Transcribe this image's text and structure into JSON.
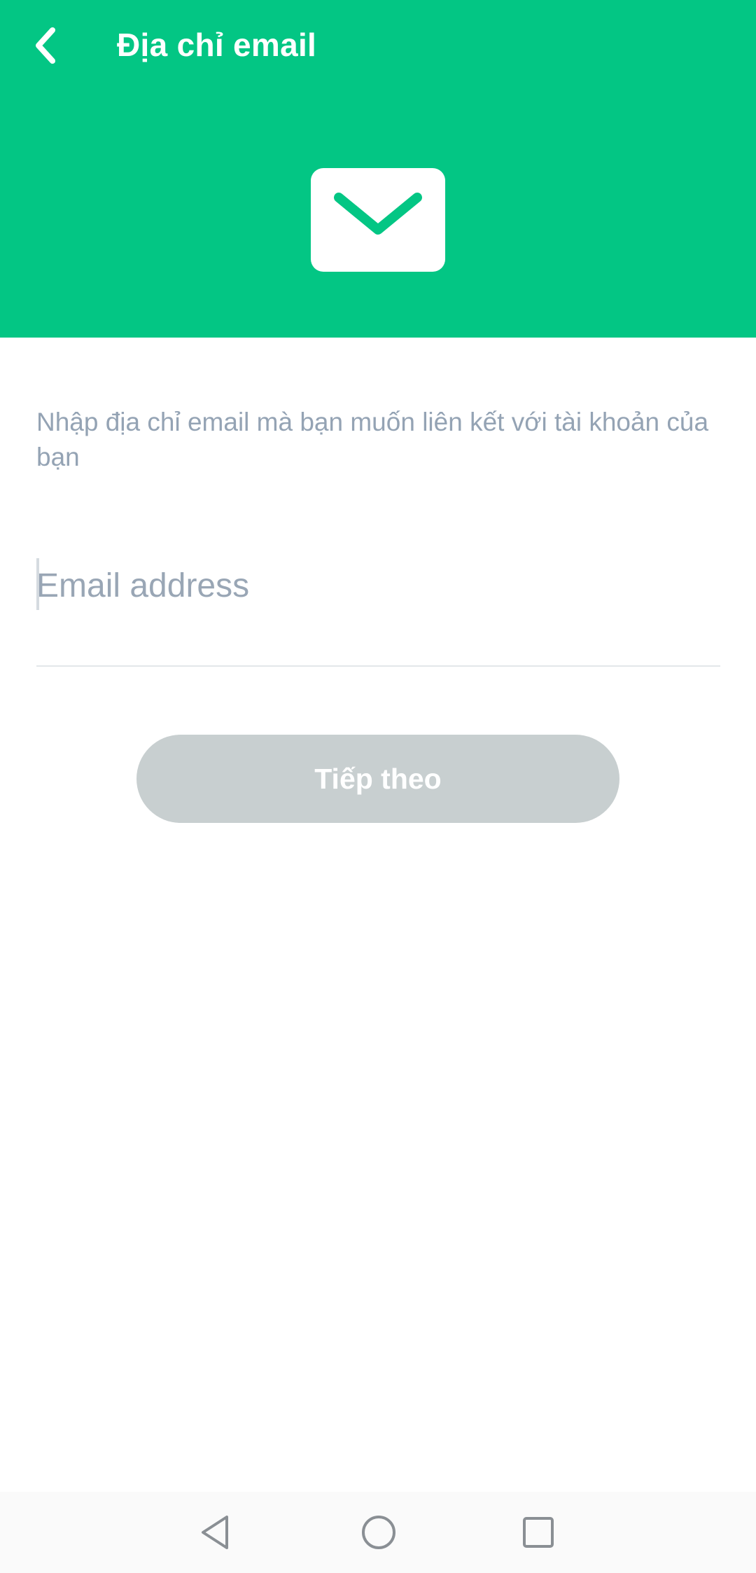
{
  "header": {
    "title": "Địa chỉ email",
    "back_icon": "chevron-left-icon",
    "mail_icon": "mail-icon",
    "background_color": "#03c684"
  },
  "main": {
    "instruction": "Nhập địa chỉ email mà bạn muốn liên kết với tài khoản của bạn",
    "email": {
      "value": "",
      "placeholder": "Email address"
    },
    "next_button": {
      "label": "Tiếp theo",
      "state": "disabled",
      "color": "#c8cfd0"
    }
  },
  "navbar": {
    "icons": [
      "nav-back-icon",
      "nav-home-icon",
      "nav-recents-icon"
    ]
  }
}
